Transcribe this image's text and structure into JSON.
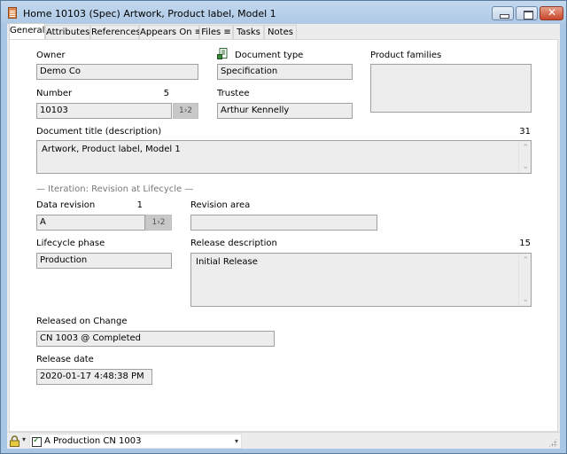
{
  "window": {
    "title": "Home 10103 (Spec) Artwork, Product label, Model 1",
    "icon": "document-icon",
    "controls": [
      "minimize",
      "maximize",
      "close"
    ]
  },
  "tabs": [
    {
      "label": "General",
      "active": true
    },
    {
      "label": "Attributes",
      "active": false
    },
    {
      "label": "References",
      "active": false
    },
    {
      "label": "Appears On ≡",
      "active": false
    },
    {
      "label": "Files ≡",
      "active": false
    },
    {
      "label": "Tasks",
      "active": false
    },
    {
      "label": "Notes",
      "active": false
    }
  ],
  "general": {
    "owner": {
      "label": "Owner",
      "value": "Demo Co"
    },
    "document_type": {
      "label": "Document type",
      "value": "Specification",
      "icon": "document-type-icon"
    },
    "product_families": {
      "label": "Product families",
      "value": ""
    },
    "number": {
      "label": "Number",
      "count": "5",
      "value": "10103",
      "sequence_button": "1›2"
    },
    "trustee": {
      "label": "Trustee",
      "value": "Arthur Kennelly"
    },
    "document_title": {
      "label": "Document title (description)",
      "count": "31",
      "value": "Artwork, Product label, Model 1"
    },
    "iteration_section": "— Iteration: Revision at Lifecycle —",
    "data_revision": {
      "label": "Data revision",
      "count": "1",
      "value": "A",
      "sequence_button": "1›2"
    },
    "revision_area": {
      "label": "Revision area",
      "value": ""
    },
    "lifecycle_phase": {
      "label": "Lifecycle phase",
      "value": "Production"
    },
    "release_description": {
      "label": "Release description",
      "count": "15",
      "value": "Initial Release"
    },
    "released_on_change": {
      "label": "Released on Change",
      "value": "CN 1003 @ Completed"
    },
    "release_date": {
      "label": "Release date",
      "value": "2020-01-17 4:48:38 PM"
    }
  },
  "statusbar": {
    "lock_icon": "lock-icon",
    "iteration_selector": {
      "checked": true,
      "value": "A Production CN 1003"
    }
  },
  "colors": {
    "titlebar": "#aec9e6",
    "field_background": "#ededed",
    "close_button": "#c8452a"
  }
}
